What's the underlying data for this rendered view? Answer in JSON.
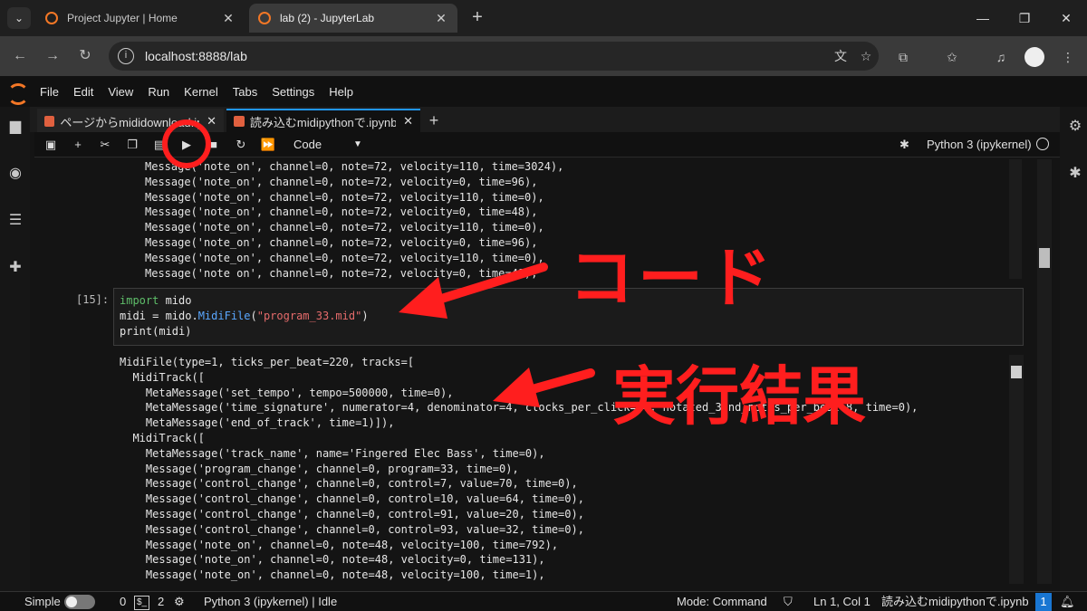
{
  "browser": {
    "tabs": [
      {
        "title": "Project Jupyter | Home",
        "active": false
      },
      {
        "title": "lab (2) - JupyterLab",
        "active": true
      }
    ],
    "url": "localhost:8888/lab"
  },
  "menubar": [
    "File",
    "Edit",
    "View",
    "Run",
    "Kernel",
    "Tabs",
    "Settings",
    "Help"
  ],
  "doc_tabs": [
    {
      "title": "ページからmididownload.ipynb",
      "active": false
    },
    {
      "title": "読み込むmidipythonで.ipynb",
      "active": true
    }
  ],
  "notebook_toolbar": {
    "cell_type": "Code",
    "kernel": "Python 3 (ipykernel)"
  },
  "output_prev": [
    "Message('note_on', channel=0, note=72, velocity=110, time=3024),",
    "Message('note_on', channel=0, note=72, velocity=0, time=96),",
    "Message('note_on', channel=0, note=72, velocity=110, time=0),",
    "Message('note_on', channel=0, note=72, velocity=0, time=48),",
    "Message('note_on', channel=0, note=72, velocity=110, time=0),",
    "Message('note_on', channel=0, note=72, velocity=0, time=96),",
    "Message('note_on', channel=0, note=72, velocity=110, time=0),",
    "Message('note_on', channel=0, note=72, velocity=0, time=48),"
  ],
  "cell": {
    "prompt": "[15]:",
    "line1_kw": "import",
    "line1_rest": " mido",
    "line2_a": "midi = mido.",
    "line2_fn": "MidiFile",
    "line2_b": "(",
    "line2_str": "\"program_33.mid\"",
    "line2_c": ")",
    "line3": "print(midi)"
  },
  "output_result": [
    "MidiFile(type=1, ticks_per_beat=220, tracks=[",
    "  MidiTrack([",
    "    MetaMessage('set_tempo', tempo=500000, time=0),",
    "    MetaMessage('time_signature', numerator=4, denominator=4, clocks_per_click=24, notated_32nd_notes_per_beat=8, time=0),",
    "    MetaMessage('end_of_track', time=1)]),",
    "  MidiTrack([",
    "    MetaMessage('track_name', name='Fingered Elec Bass', time=0),",
    "    Message('program_change', channel=0, program=33, time=0),",
    "    Message('control_change', channel=0, control=7, value=70, time=0),",
    "    Message('control_change', channel=0, control=10, value=64, time=0),",
    "    Message('control_change', channel=0, control=91, value=20, time=0),",
    "    Message('control_change', channel=0, control=93, value=32, time=0),",
    "    Message('note_on', channel=0, note=48, velocity=100, time=792),",
    "    Message('note_on', channel=0, note=48, velocity=0, time=131),",
    "    Message('note_on', channel=0, note=48, velocity=100, time=1),"
  ],
  "statusbar": {
    "mode_label": "Simple",
    "terminals": "0",
    "kernels": "2",
    "kernel_status": "Python 3 (ipykernel) | Idle",
    "mode": "Mode: Command",
    "position": "Ln 1, Col 1",
    "filename": "読み込むmidipythonで.ipynb",
    "notifications": "1"
  },
  "annotations": {
    "code": "コード",
    "result": "実行結果"
  },
  "colors": {
    "annotation": "#ff1e1e",
    "jupyter_orange": "#f37726",
    "active_tab": "#2196f3"
  }
}
